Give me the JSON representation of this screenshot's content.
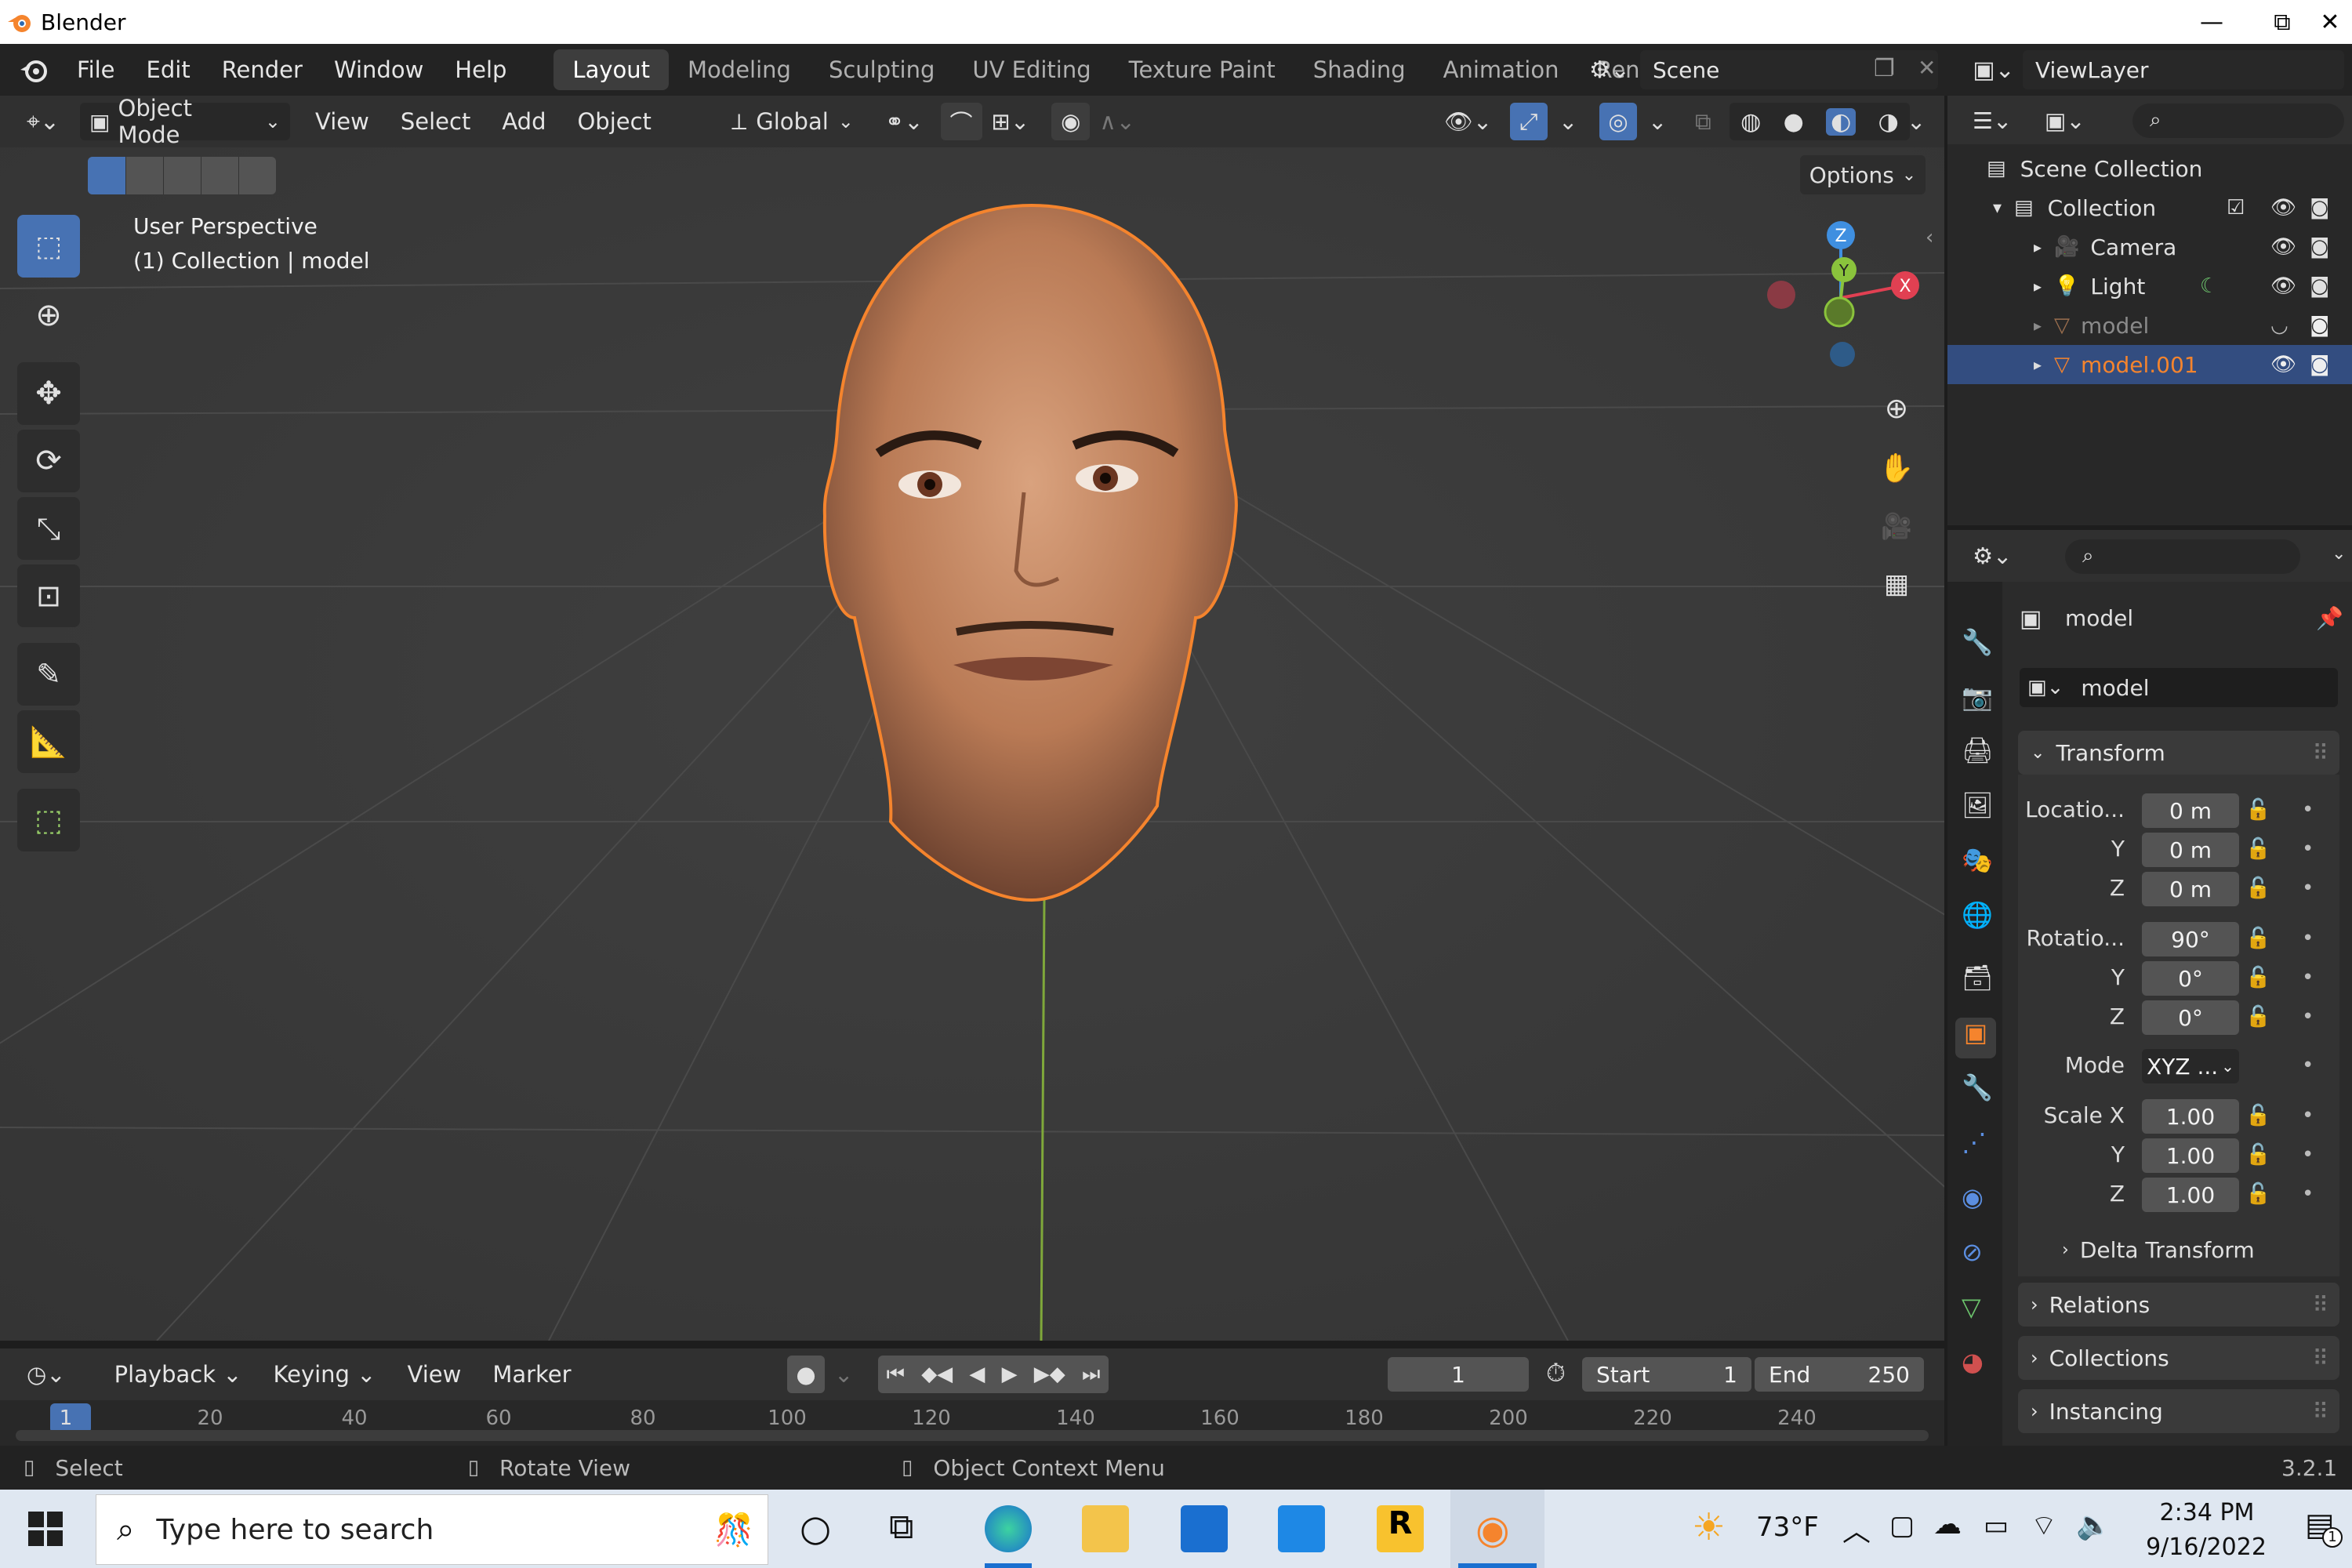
{
  "window": {
    "app_title": "Blender",
    "minimize": "—",
    "maximize": "⧉",
    "close": "✕"
  },
  "menu": {
    "file": "File",
    "edit": "Edit",
    "render": "Render",
    "window": "Window",
    "help": "Help"
  },
  "workspaces": [
    "Layout",
    "Modeling",
    "Sculpting",
    "UV Editing",
    "Texture Paint",
    "Shading",
    "Animation",
    "Rend"
  ],
  "scene": {
    "name": "Scene",
    "view_layer": "ViewLayer"
  },
  "viewport_header": {
    "mode": "Object Mode",
    "view": "View",
    "select": "Select",
    "add": "Add",
    "object": "Object",
    "transform_orientation": "Global",
    "options": "Options"
  },
  "viewport": {
    "perspective": "User Perspective",
    "collection_info": "(1) Collection | model",
    "gizmo": {
      "z": "Z",
      "y": "Y",
      "x": "X"
    }
  },
  "timeline": {
    "playback": "Playback",
    "keying": "Keying",
    "view": "View",
    "marker": "Marker",
    "current_frame": "1",
    "start_label": "Start",
    "start": "1",
    "end_label": "End",
    "end": "250",
    "ticks": [
      "1",
      "20",
      "40",
      "60",
      "80",
      "100",
      "120",
      "140",
      "160",
      "180",
      "200",
      "220",
      "240"
    ]
  },
  "statusbar": {
    "select": "Select",
    "rotate": "Rotate View",
    "context": "Object Context Menu",
    "version": "3.2.1"
  },
  "outliner": {
    "scene_collection": "Scene Collection",
    "items": [
      {
        "label": "Collection"
      },
      {
        "label": "Camera"
      },
      {
        "label": "Light"
      },
      {
        "label": "model"
      },
      {
        "label": "model.001"
      }
    ]
  },
  "properties": {
    "object_name": "model",
    "datablock": "model",
    "transform": "Transform",
    "location_label": "Locatio...",
    "location": [
      "0 m",
      "0 m",
      "0 m"
    ],
    "rotation_label": "Rotatio...",
    "rotation": [
      "90°",
      "0°",
      "0°"
    ],
    "mode_label": "Mode",
    "mode": "XYZ ...",
    "scale_label": "Scale X",
    "scale": [
      "1.00",
      "1.00",
      "1.00"
    ],
    "y": "Y",
    "z": "Z",
    "delta": "Delta Transform",
    "relations": "Relations",
    "collections": "Collections",
    "instancing": "Instancing"
  },
  "taskbar": {
    "search_placeholder": "Type here to search",
    "weather": "73°F",
    "time": "2:34 PM",
    "date": "9/16/2022",
    "notifications": "1"
  },
  "colors": {
    "accent_blue": "#4772b3",
    "selected_orange": "#f5842d",
    "axis_x": "#e14052",
    "axis_y": "#8ac33c",
    "axis_z": "#3f8fe0"
  }
}
